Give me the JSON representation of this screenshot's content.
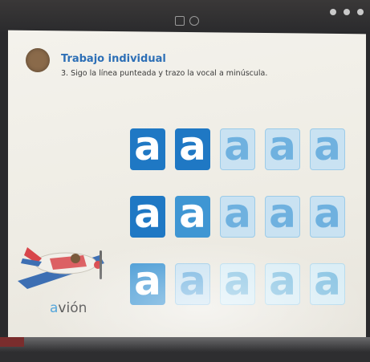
{
  "header": {
    "title": "Trabajo individual",
    "instruction": "3. Sigo la línea punteada y trazo la vocal a minúscula."
  },
  "exercise": {
    "letter": "a",
    "rows": [
      [
        "dark",
        "dark",
        "light",
        "light",
        "light"
      ],
      [
        "dark",
        "mid",
        "light",
        "light",
        "light"
      ],
      [
        "mid",
        "light",
        "faint",
        "faint",
        "faint"
      ]
    ]
  },
  "word": {
    "first_letter": "a",
    "rest": "vión"
  },
  "colors": {
    "title_blue": "#2d6fb6",
    "tile_dark": "#1f78c4",
    "tile_light": "#c9e2f2"
  },
  "icons": [
    "airplane-illustration",
    "avatar-badge"
  ]
}
